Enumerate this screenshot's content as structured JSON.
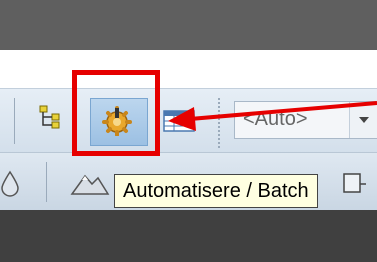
{
  "toolbar": {
    "automation_button_tooltip": "Automatisere / Batch",
    "combo_value": "<Auto>"
  },
  "annotations": {
    "highlight_color": "#e60000",
    "arrow_color": "#e60000"
  },
  "icons": {
    "tree": "tree-hierarchy-icon",
    "automation": "gear-icon",
    "table": "table-icon",
    "drop": "drop-icon",
    "mountain": "mountain-icon"
  }
}
